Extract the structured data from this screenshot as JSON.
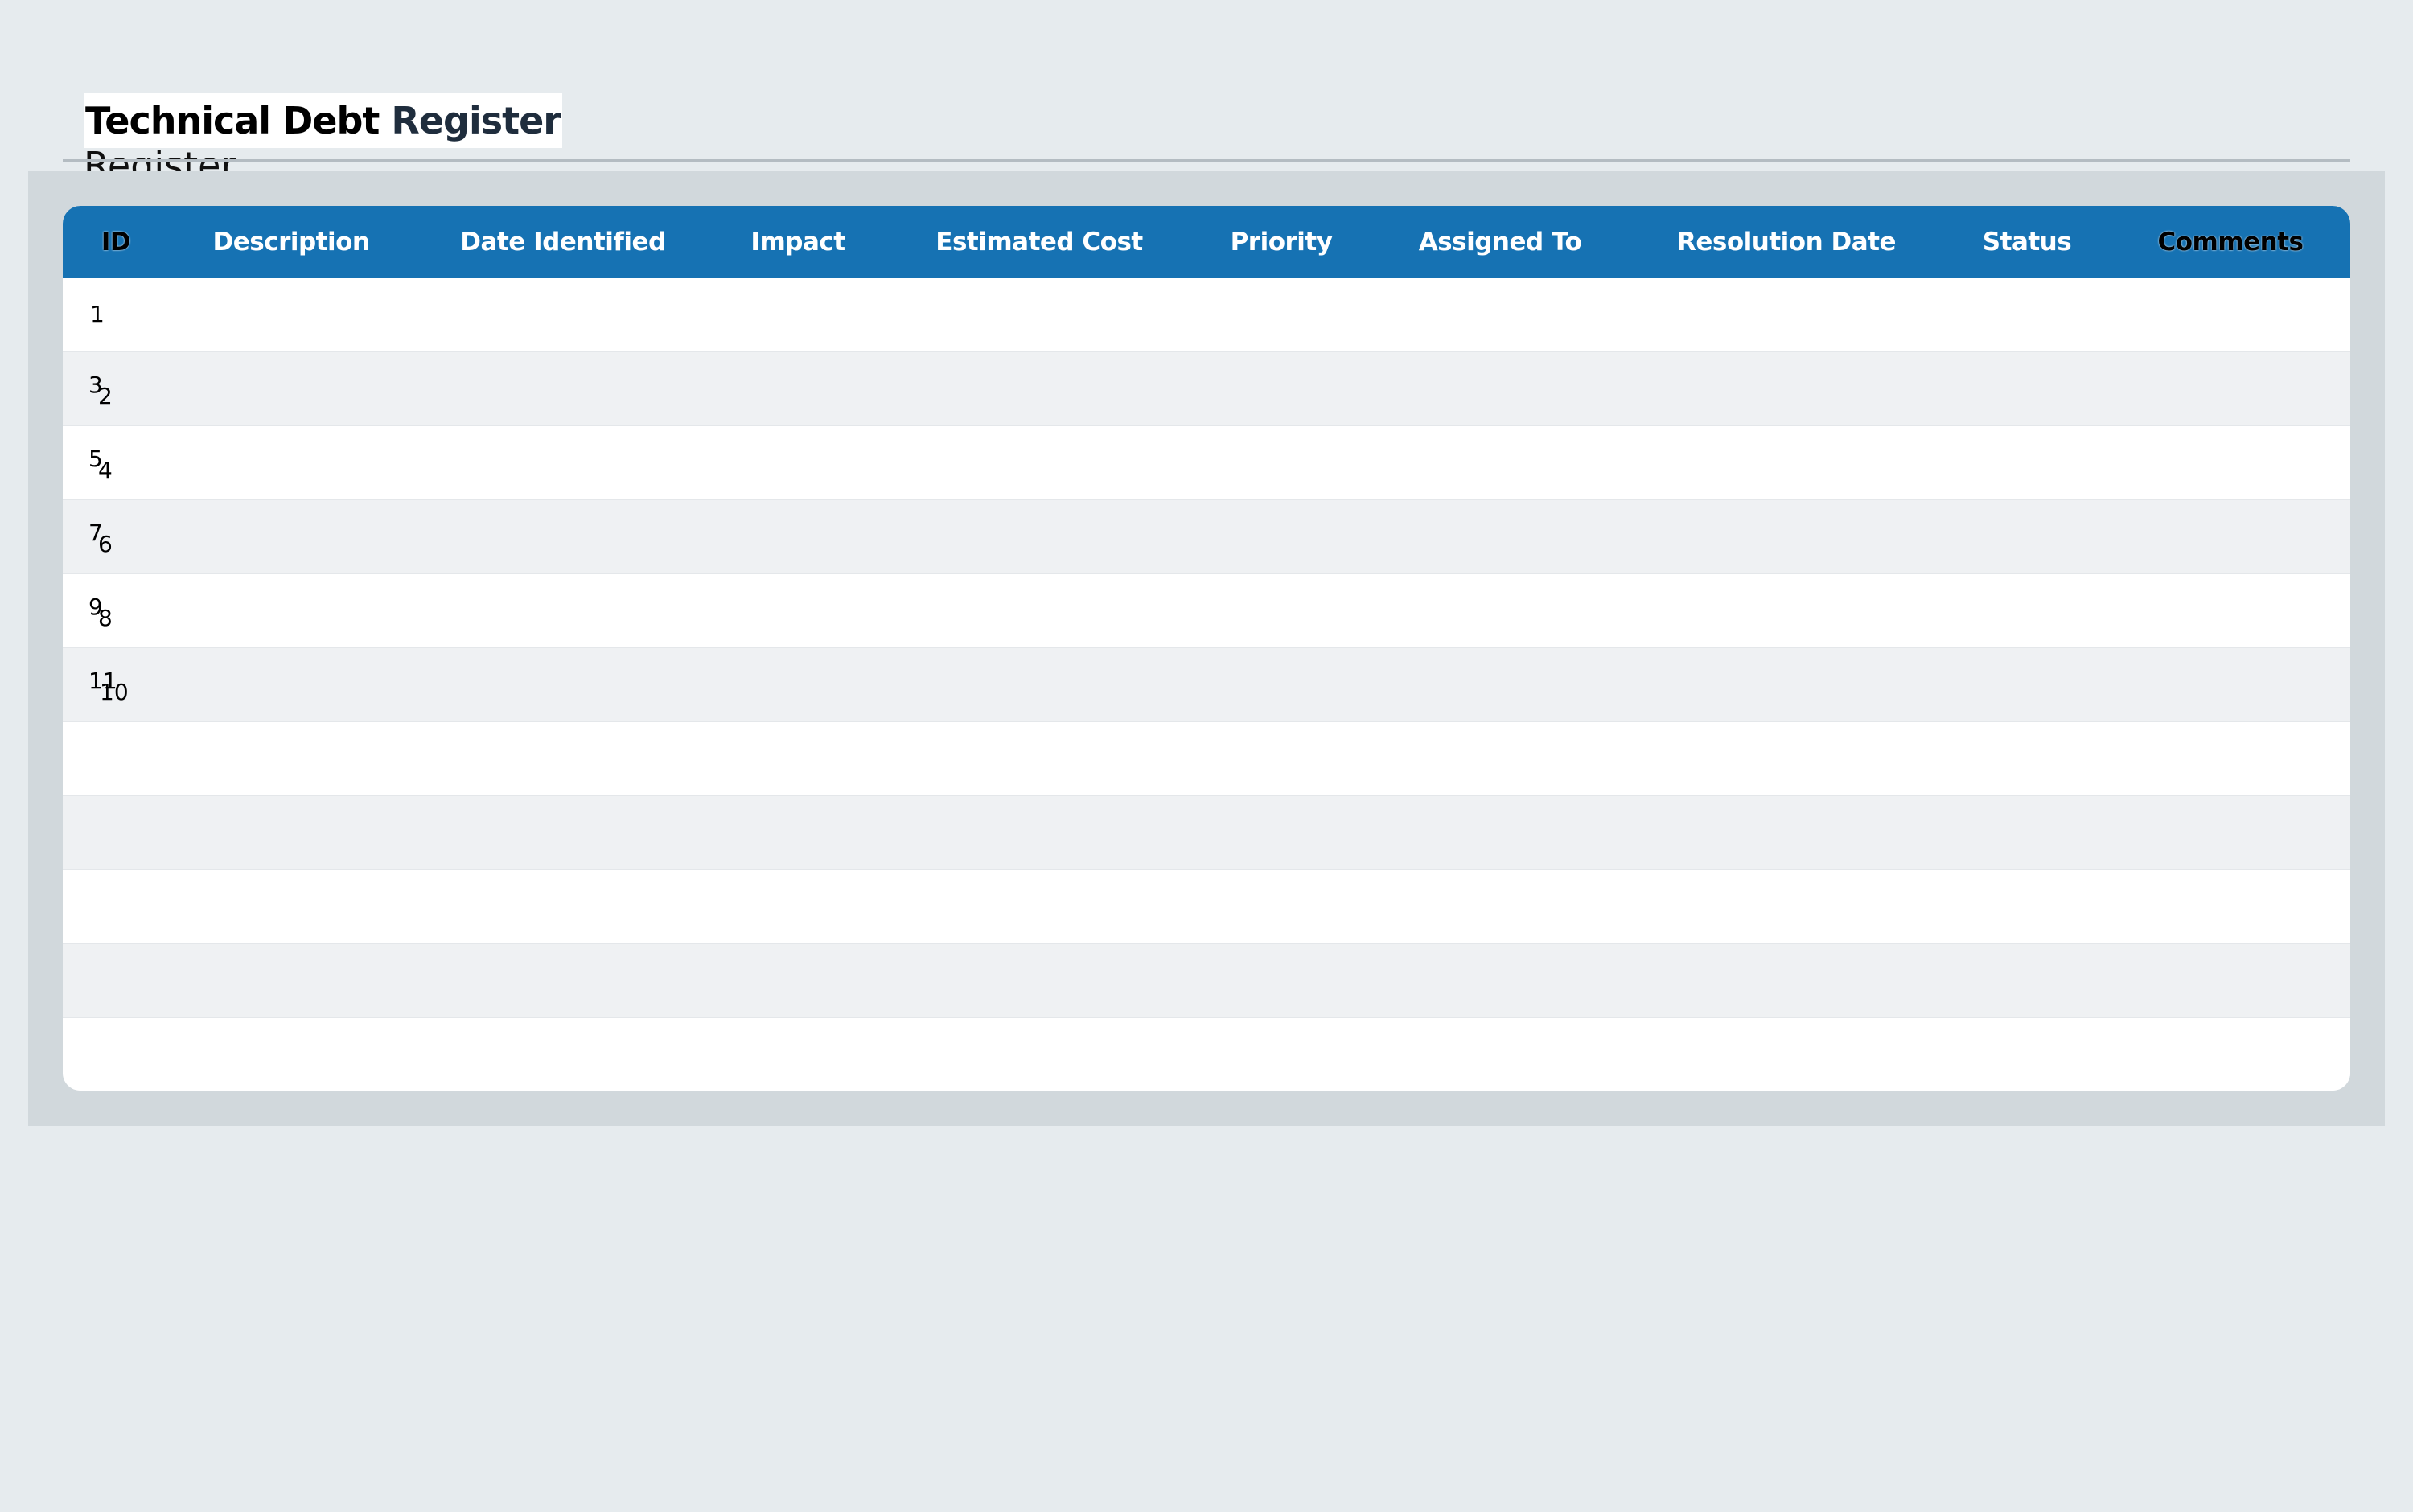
{
  "header": {
    "title_bold": "Technical Debt",
    "title_accent": "Register",
    "title_ghost": "Register"
  },
  "table": {
    "columns": [
      "ID",
      "Description",
      "Date Identified",
      "Impact",
      "Estimated Cost",
      "Priority",
      "Assigned To",
      "Resolution Date",
      "Status",
      "Comments"
    ],
    "rows": [
      {
        "id": "1",
        "id_overlap": ""
      },
      {
        "id": "3",
        "id_overlap": "2"
      },
      {
        "id": "5",
        "id_overlap": "4"
      },
      {
        "id": "7",
        "id_overlap": "6"
      },
      {
        "id": "9",
        "id_overlap": "8"
      },
      {
        "id": "11",
        "id_overlap": "10"
      },
      {
        "id": "",
        "id_overlap": ""
      },
      {
        "id": "",
        "id_overlap": ""
      },
      {
        "id": "",
        "id_overlap": ""
      },
      {
        "id": "",
        "id_overlap": ""
      },
      {
        "id": "",
        "id_overlap": ""
      }
    ]
  },
  "colors": {
    "header_bar": "#1672b3",
    "page_bg": "#e6ebee",
    "panel_bg": "#d1d8dc",
    "row_alt": "#eff1f3"
  }
}
